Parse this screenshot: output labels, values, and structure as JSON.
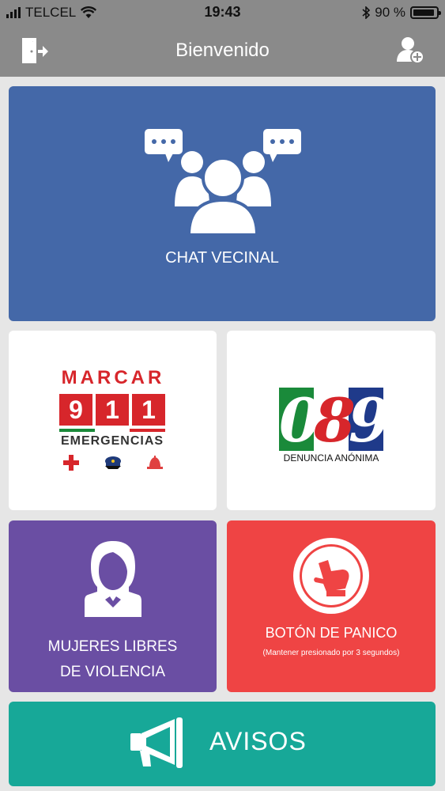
{
  "status": {
    "carrier": "TELCEL",
    "time": "19:43",
    "battery": "90 %"
  },
  "header": {
    "title": "Bienvenido",
    "exit_icon": "exit-door-icon",
    "add_user_icon": "add-user-icon"
  },
  "tiles": {
    "chat": {
      "label": "CHAT VECINAL",
      "color": "#4468a8"
    },
    "marcar911": {
      "line1": "MARCAR",
      "digits": [
        "9",
        "1",
        "1"
      ],
      "line2": "EMERGENCIAS"
    },
    "denuncia089": {
      "digits": [
        "0",
        "8",
        "9"
      ],
      "caption": "DENUNCIA ANÓNIMA"
    },
    "mujeres": {
      "line1": "MUJERES LIBRES",
      "line2": "DE VIOLENCIA",
      "color": "#6a4ea3"
    },
    "panico": {
      "label": "BOTÓN DE PANICO",
      "sublabel": "(Mantener presionado por 3 segundos)",
      "color": "#ef4444"
    },
    "avisos": {
      "label": "AVISOS",
      "color": "#17a898"
    }
  }
}
